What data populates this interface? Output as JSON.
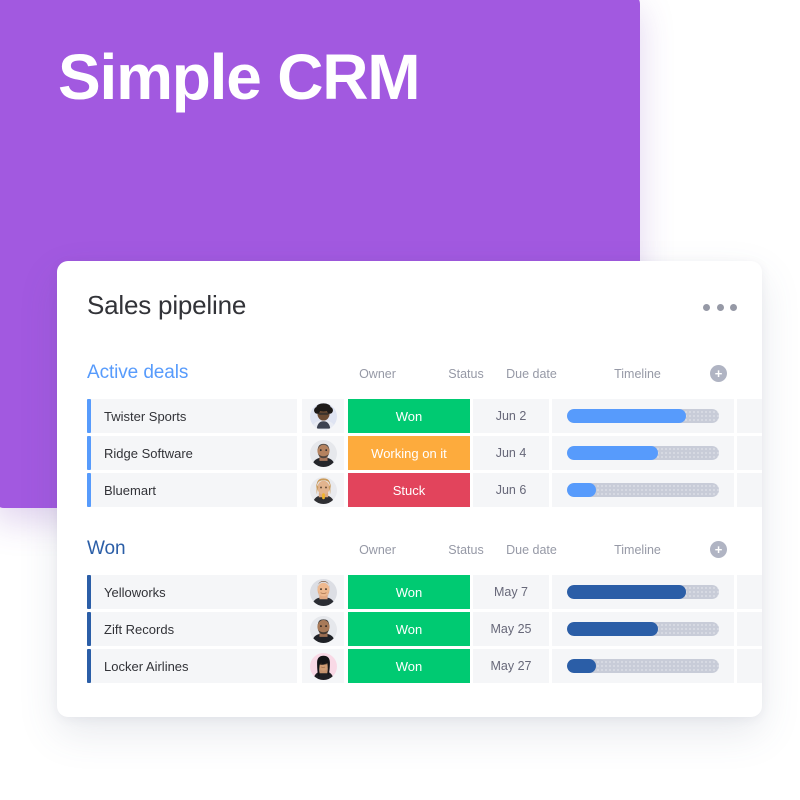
{
  "hero": {
    "title": "Simple CRM",
    "background_color": "#a259e0"
  },
  "board": {
    "title": "Sales pipeline",
    "menu_icon": "more-horizontal-icon",
    "columns": [
      "Owner",
      "Status",
      "Due date",
      "Timeline"
    ],
    "add_column_label": "+",
    "groups": [
      {
        "name": "Active deals",
        "accent_color": "#579bfc",
        "bar_color": "#579bfc",
        "columns": {
          "owner": "Owner",
          "status": "Status",
          "due": "Due date",
          "timeline": "Timeline"
        },
        "rows": [
          {
            "name": "Twister Sports",
            "owner_avatar": "avatar-woman-curly-hair",
            "status": "Won",
            "status_color": "#00ca72",
            "due_date": "Jun 2",
            "timeline_percent": 78
          },
          {
            "name": "Ridge Software",
            "owner_avatar": "avatar-man-beard",
            "status": "Working on it",
            "status_color": "#fdab3d",
            "due_date": "Jun 4",
            "timeline_percent": 60
          },
          {
            "name": "Bluemart",
            "owner_avatar": "avatar-woman-blonde",
            "status": "Stuck",
            "status_color": "#e2445c",
            "due_date": "Jun 6",
            "timeline_percent": 19
          }
        ]
      },
      {
        "name": "Won",
        "accent_color": "#2b5ea7",
        "bar_color": "#2b5ea7",
        "columns": {
          "owner": "Owner",
          "status": "Status",
          "due": "Due date",
          "timeline": "Timeline"
        },
        "rows": [
          {
            "name": "Yelloworks",
            "owner_avatar": "avatar-man-short-hair",
            "status": "Won",
            "status_color": "#00ca72",
            "due_date": "May 7",
            "timeline_percent": 78
          },
          {
            "name": "Zift Records",
            "owner_avatar": "avatar-man-beard-dark",
            "status": "Won",
            "status_color": "#00ca72",
            "due_date": "May 25",
            "timeline_percent": 60
          },
          {
            "name": "Locker Airlines",
            "owner_avatar": "avatar-woman-dark-hair",
            "status": "Won",
            "status_color": "#00ca72",
            "due_date": "May 27",
            "timeline_percent": 19
          }
        ]
      }
    ]
  }
}
